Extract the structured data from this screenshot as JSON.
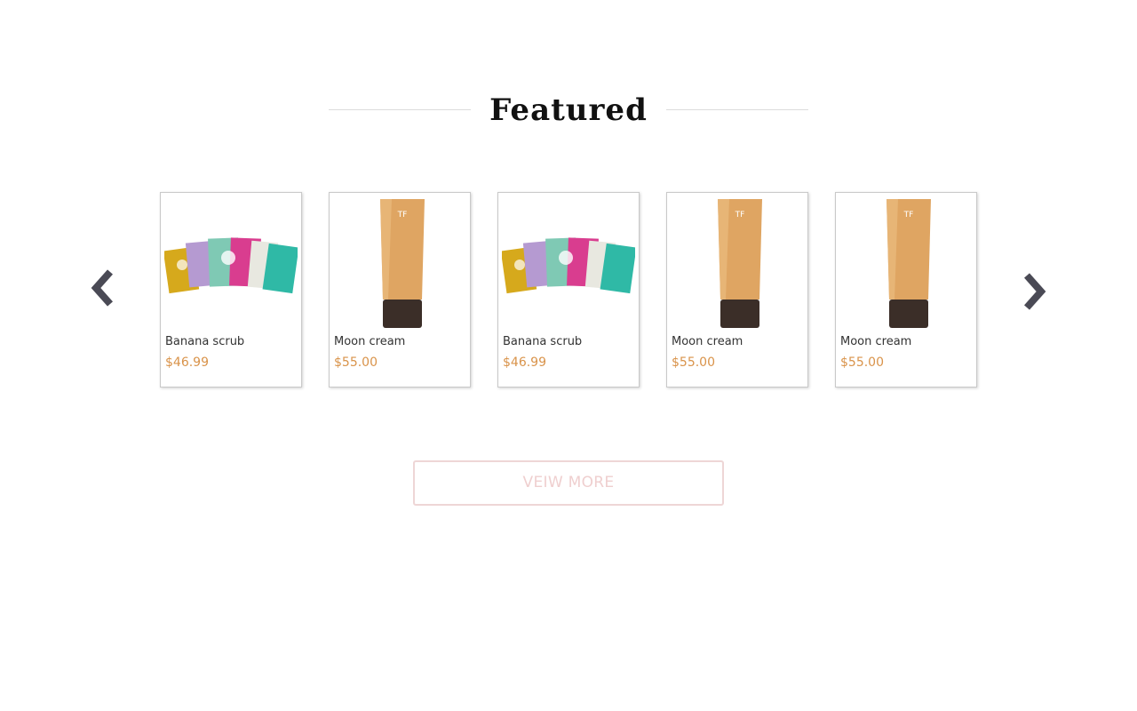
{
  "section": {
    "title": "Featured"
  },
  "carousel": {
    "prev_icon": "chevron-left-icon",
    "next_icon": "chevron-right-icon",
    "products": [
      {
        "name": "Banana scrub",
        "price": "$46.99",
        "image": "face-mask-sachets"
      },
      {
        "name": "Moon cream",
        "price": "$55.00",
        "image": "tinted-cream-tube"
      },
      {
        "name": "Banana scrub",
        "price": "$46.99",
        "image": "face-mask-sachets"
      },
      {
        "name": "Moon cream",
        "price": "$55.00",
        "image": "tinted-cream-tube"
      },
      {
        "name": "Moon cream",
        "price": "$55.00",
        "image": "tinted-cream-tube"
      }
    ]
  },
  "actions": {
    "view_more_label": "VEIW MORE"
  },
  "colors": {
    "price": "#d9934a",
    "arrow": "#4a4a55",
    "button_border": "#eed6d6",
    "button_text": "#efcfcf"
  }
}
